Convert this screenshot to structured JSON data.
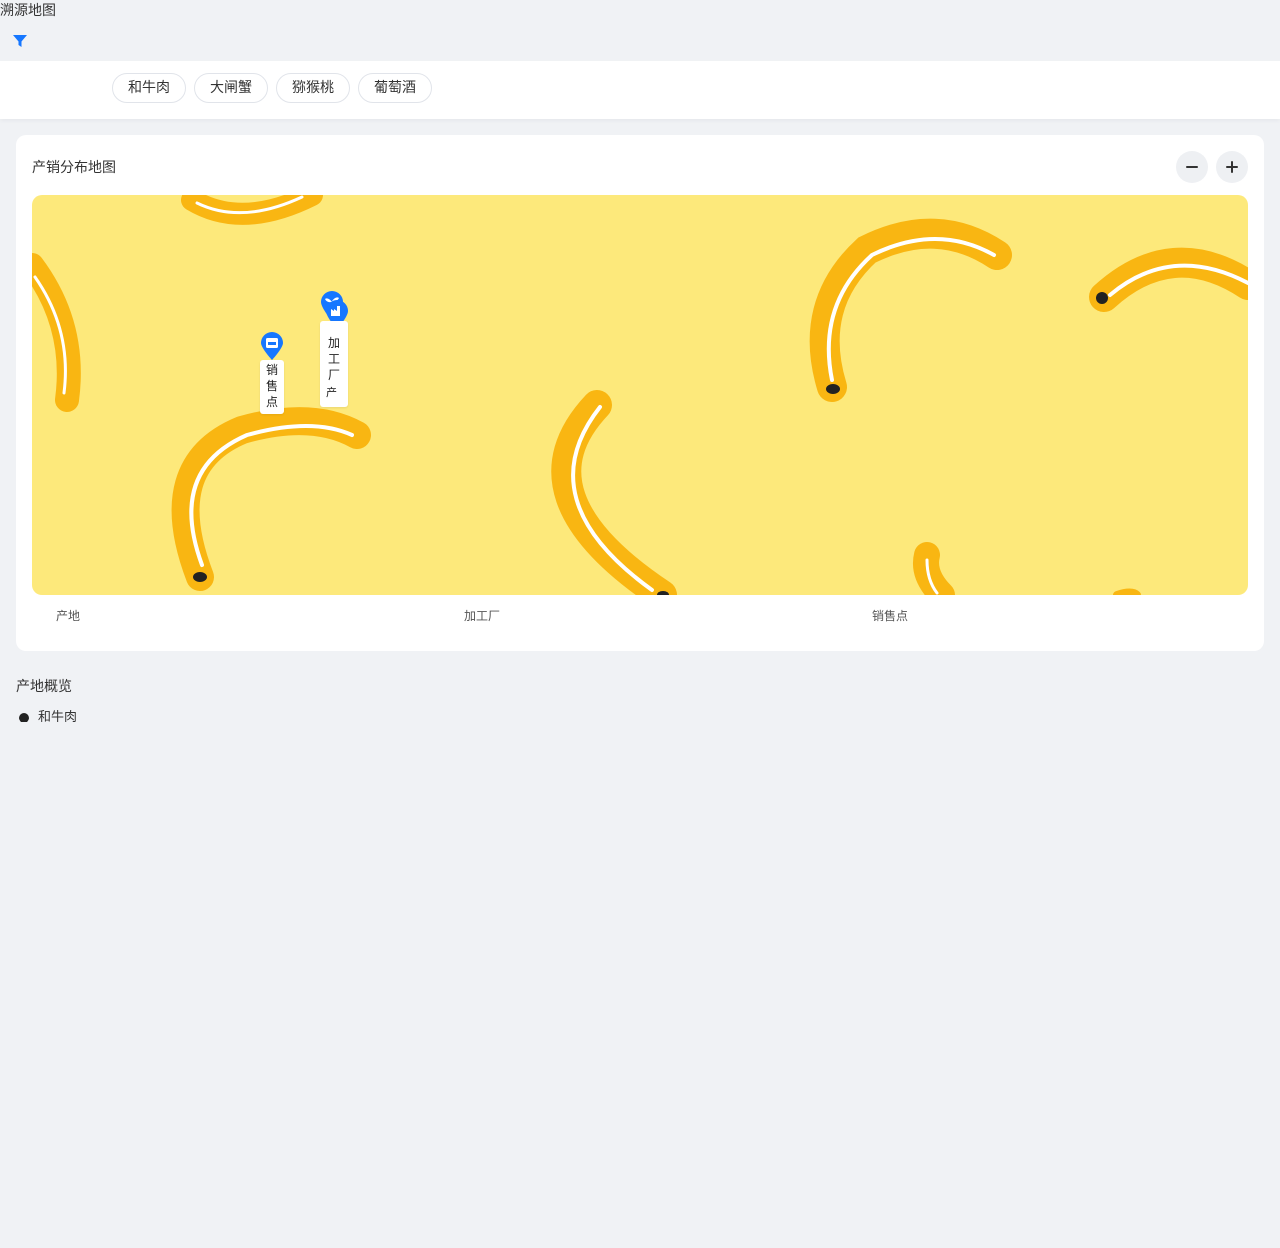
{
  "page": {
    "title": "溯源地图"
  },
  "filter": {
    "icon": "filter-icon",
    "color": "#1677ff"
  },
  "chips": [
    {
      "label": "和牛肉"
    },
    {
      "label": "大闸蟹"
    },
    {
      "label": "猕猴桃"
    },
    {
      "label": "葡萄酒"
    }
  ],
  "map_card": {
    "title": "产销分布地图",
    "zoom_out_icon": "minus-icon",
    "zoom_in_icon": "plus-icon",
    "background": "#fde97b",
    "markers": [
      {
        "type": "origin",
        "icon": "sprout-icon",
        "label": "产地"
      },
      {
        "type": "factory",
        "icon": "factory-icon",
        "label": "加工厂"
      },
      {
        "type": "store",
        "icon": "store-icon",
        "label": "销售点"
      }
    ],
    "legend": [
      "产地",
      "加工厂",
      "销售点"
    ]
  },
  "overview": {
    "title": "产地概览",
    "items": [
      {
        "label": "和牛肉",
        "icon": "pin-icon"
      }
    ]
  },
  "colors": {
    "accent": "#1677ff",
    "banana": "#f9b612",
    "map_bg": "#fde97b"
  }
}
